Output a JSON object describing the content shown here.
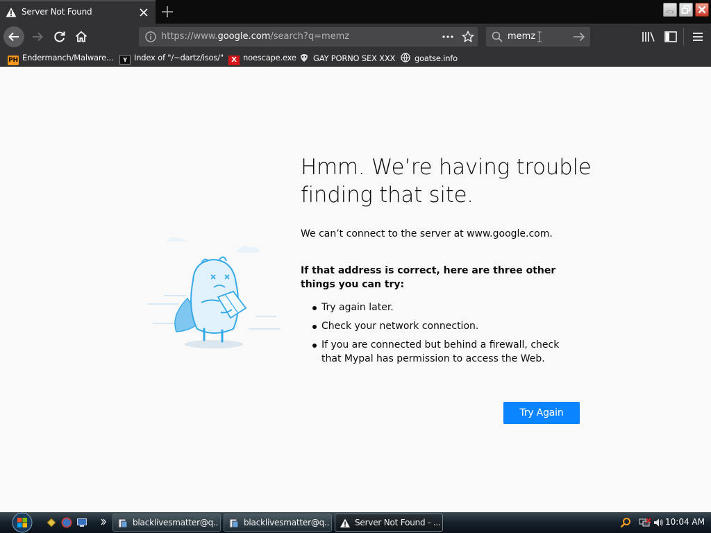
{
  "tab": {
    "title": "Server Not Found"
  },
  "navbar": {
    "url_prefix": "https://www.",
    "url_domain": "google.com",
    "url_suffix": "/search?q=memz",
    "search_value": "memz"
  },
  "bookmarks": [
    {
      "icon_text": "PH",
      "label": "Endermanch/Malware..."
    },
    {
      "icon_text": "Y",
      "label": "Index of \"/~dartz/isos/\""
    },
    {
      "icon_text": "X",
      "label": "noescape.exe"
    },
    {
      "icon_text": "",
      "label": "GAY PORNO SEX XXX"
    },
    {
      "icon_text": "",
      "label": "goatse.info"
    }
  ],
  "error": {
    "heading": "Hmm. We’re having trouble finding that site.",
    "description": "We can’t connect to the server at www.google.com.",
    "try_heading": "If that address is correct, here are three other things you can try:",
    "tips": [
      "Try again later.",
      "Check your network connection.",
      "If you are connected but behind a firewall, check that Mypal has permission to access the Web."
    ],
    "button_label": "Try Again"
  },
  "taskbar": {
    "tasks": [
      {
        "label": "blacklivesmatter@q..."
      },
      {
        "label": "blacklivesmatter@q..."
      },
      {
        "label": "Server Not Found - ..."
      }
    ],
    "clock": "10:04 AM"
  },
  "colors": {
    "accent": "#0a84ff",
    "chrome_dark": "#323234",
    "tab_strip": "#0c0c0d",
    "page_bg": "#f9f9fa"
  }
}
